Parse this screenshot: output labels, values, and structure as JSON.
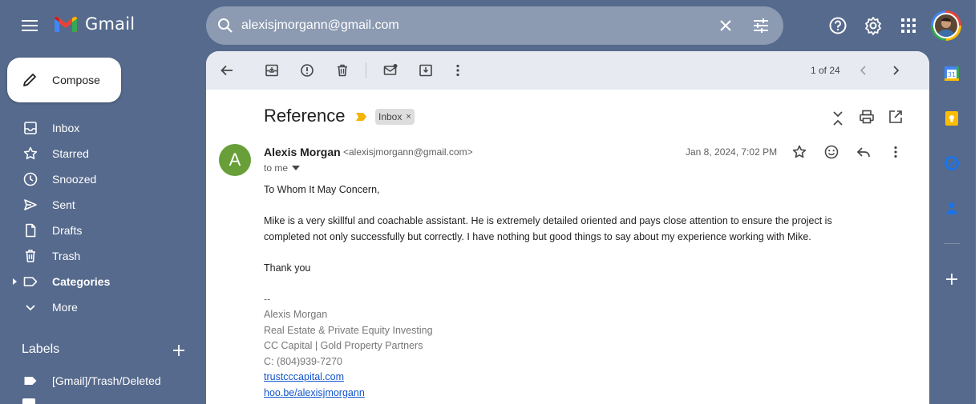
{
  "app": {
    "name": "Gmail"
  },
  "search": {
    "value": "alexisjmorgann@gmail.com"
  },
  "sidebar": {
    "compose_label": "Compose",
    "items": [
      {
        "label": "Inbox",
        "icon": "inbox-icon"
      },
      {
        "label": "Starred",
        "icon": "star-icon"
      },
      {
        "label": "Snoozed",
        "icon": "clock-icon"
      },
      {
        "label": "Sent",
        "icon": "send-icon"
      },
      {
        "label": "Drafts",
        "icon": "draft-icon"
      },
      {
        "label": "Trash",
        "icon": "trash-icon"
      },
      {
        "label": "Categories",
        "icon": "label-icon"
      },
      {
        "label": "More",
        "icon": "chevron-down-icon"
      }
    ],
    "labels_title": "Labels",
    "labels": [
      {
        "label": "[Gmail]/Trash/Deleted"
      }
    ]
  },
  "toolbar": {
    "pager": "1 of 24"
  },
  "email": {
    "subject": "Reference",
    "inbox_chip": "Inbox",
    "chip_close": "×",
    "avatar_letter": "A",
    "sender_name": "Alexis Morgan",
    "sender_email": "<alexisjmorgann@gmail.com>",
    "to": "to me",
    "date": "Jan 8, 2024, 7:02 PM",
    "greeting": "To Whom It May Concern,",
    "para1": "Mike is a very skillful and coachable assistant. He is extremely detailed oriented and pays close attention to ensure the project is",
    "para2": "completed not only successfully but correctly. I have nothing but good things to say about my experience working with Mike.",
    "closing": "Thank you",
    "sig_sep": "--",
    "sig_name": "Alexis Morgan",
    "sig_title": "Real Estate & Private Equity Investing",
    "sig_company": "CC Capital | Gold Property Partners",
    "sig_phone": "C: (804)939-7270",
    "sig_link1": "trustcccapital.com",
    "sig_link2": "hoo.be/alexisjmorgann"
  },
  "colors": {
    "background": "#566a8d",
    "search_bg": "#8c9ab2",
    "toolbar_bg": "#e7ebf1",
    "avatar_green": "#689f38",
    "link": "#1155cc"
  }
}
